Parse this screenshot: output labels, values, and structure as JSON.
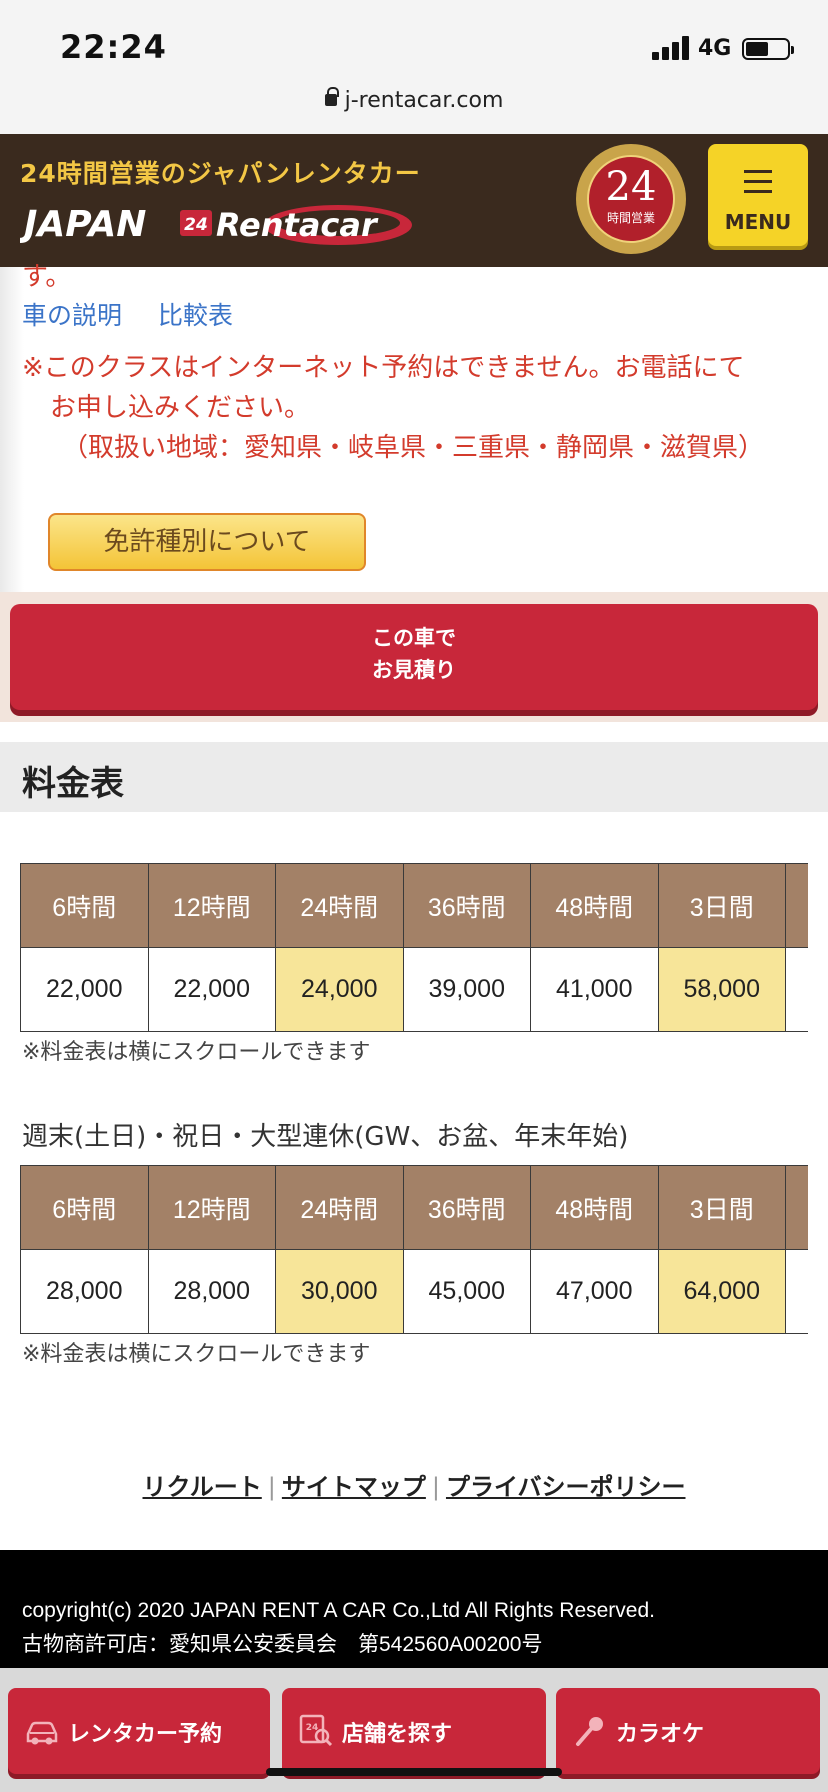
{
  "status_bar": {
    "time": "22:24",
    "network": "4G"
  },
  "browser": {
    "url": "j-rentacar.com"
  },
  "header": {
    "tagline": "24時間営業のジャパンレンタカー",
    "logo_text": "JAPAN24Rentacar",
    "badge_number": "24",
    "badge_caption": "時間営業",
    "menu_label": "MENU",
    "colors": {
      "header_bg": "#3a2a1e",
      "tagline": "#f3c745",
      "menu_button": "#f5d327"
    }
  },
  "content": {
    "cutoff_text": "す。",
    "links": [
      "車の説明",
      "比較表"
    ],
    "notice_lines": [
      "※このクラスはインターネット予約はできません。お電話にて",
      "お申し込みください。",
      "（取扱い地域：愛知県・岐阜県・三重県・静岡県・滋賀県）"
    ],
    "license_button": "免許種別について",
    "quote_button": [
      "この車で",
      "お見積り"
    ]
  },
  "rates": {
    "title": "料金表",
    "headers": [
      "6時間",
      "12時間",
      "24時間",
      "36時間",
      "48時間",
      "3日間"
    ],
    "weekday_values": [
      "22,000",
      "22,000",
      "24,000",
      "39,000",
      "41,000",
      "58,000"
    ],
    "scroll_note": "※料金表は横にスクロールできます",
    "weekend_label": "週末(土日)・祝日・大型連休(GW、お盆、年末年始)",
    "weekend_values": [
      "28,000",
      "28,000",
      "30,000",
      "45,000",
      "47,000",
      "64,000"
    ],
    "highlight_color": "#f7e599",
    "header_color": "#a38167"
  },
  "footer": {
    "links": [
      "リクルート",
      "サイトマップ",
      "プライバシーポリシー"
    ],
    "copyright": "copyright(c) 2020 JAPAN RENT A CAR Co.,Ltd All Rights Reserved.",
    "license_line": "古物商許可店：愛知県公安委員会　第542560A00200号"
  },
  "tabbar": {
    "items": [
      {
        "label": "レンタカー予約",
        "icon": "car-icon"
      },
      {
        "label": "店舗を探す",
        "icon": "store-search-icon"
      },
      {
        "label": "カラオケ",
        "icon": "microphone-icon"
      }
    ]
  }
}
